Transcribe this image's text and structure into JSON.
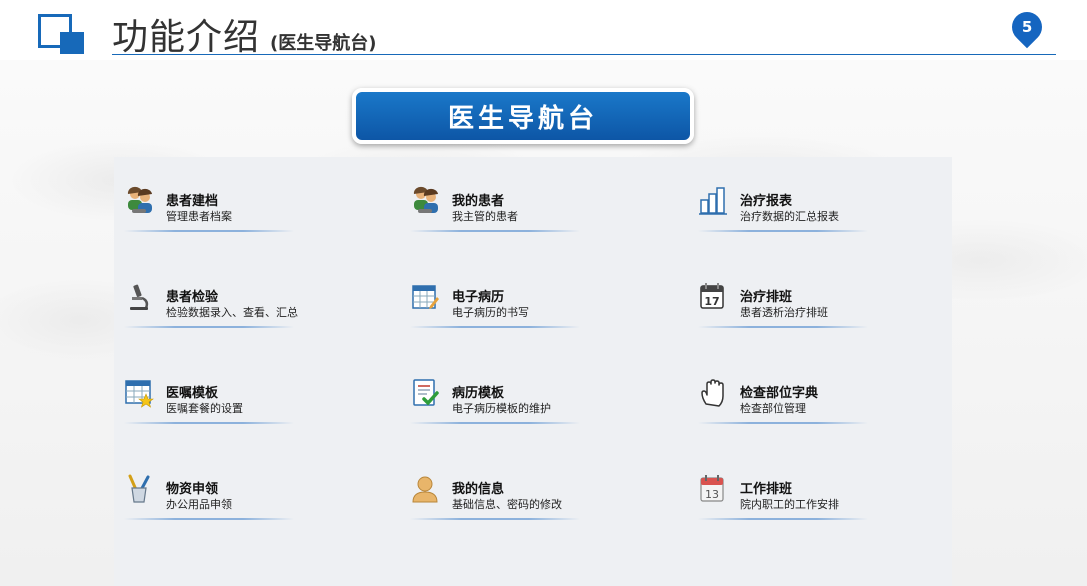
{
  "header": {
    "title": "功能介绍",
    "subtitle": "(医生导航台)",
    "page_number": "5",
    "accent_color": "#1769b9"
  },
  "banner": {
    "text": "医生导航台"
  },
  "items": [
    {
      "label": "患者建档",
      "desc": "管理患者档案",
      "icon": "patients-icon"
    },
    {
      "label": "我的患者",
      "desc": "我主管的患者",
      "icon": "patients-icon"
    },
    {
      "label": "治疗报表",
      "desc": "治疗数据的汇总报表",
      "icon": "bar-chart-icon"
    },
    {
      "label": "患者检验",
      "desc": "检验数据录入、查看、汇总",
      "icon": "microscope-icon"
    },
    {
      "label": "电子病历",
      "desc": "电子病历的书写",
      "icon": "spreadsheet-edit-icon"
    },
    {
      "label": "治疗排班",
      "desc": "患者透析治疗排班",
      "icon": "calendar-17-icon"
    },
    {
      "label": "医嘱模板",
      "desc": "医嘱套餐的设置",
      "icon": "table-star-icon"
    },
    {
      "label": "病历模板",
      "desc": "电子病历模板的维护",
      "icon": "document-check-icon"
    },
    {
      "label": "检查部位字典",
      "desc": "检查部位管理",
      "icon": "hand-icon"
    },
    {
      "label": "物资申领",
      "desc": "办公用品申领",
      "icon": "tools-cup-icon"
    },
    {
      "label": "我的信息",
      "desc": "基础信息、密码的修改",
      "icon": "user-icon"
    },
    {
      "label": "工作排班",
      "desc": "院内职工的工作安排",
      "icon": "calendar-13-icon"
    }
  ]
}
